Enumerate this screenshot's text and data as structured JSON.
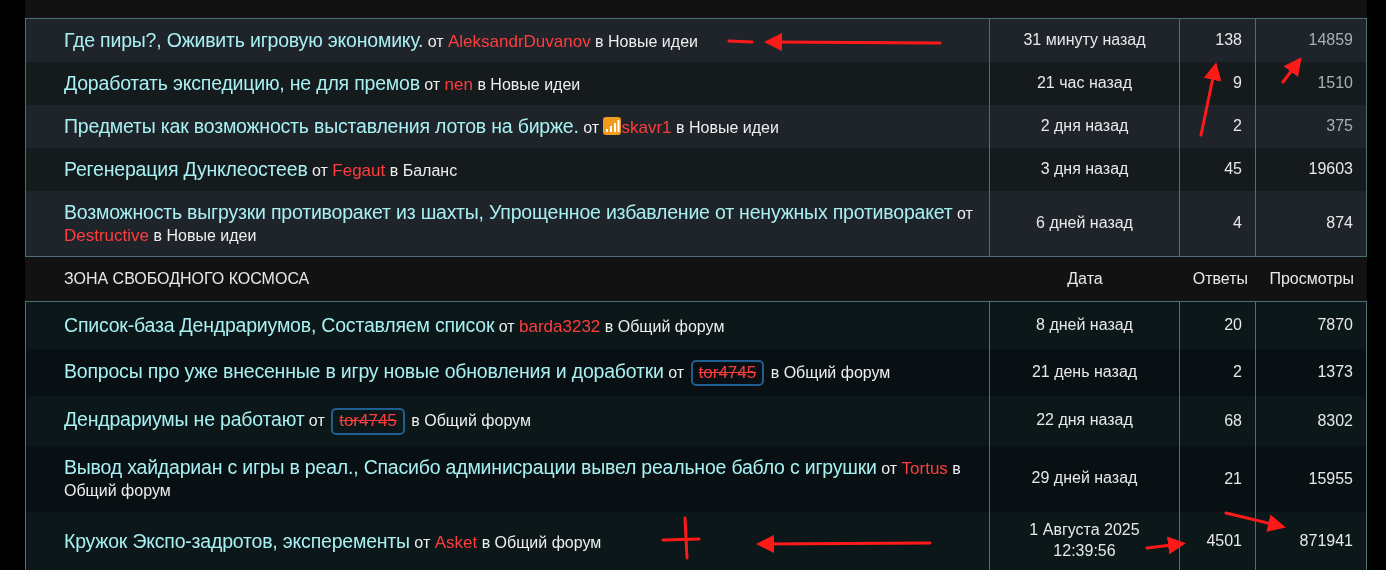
{
  "sections": [
    {
      "rows": [
        {
          "title": "Где пиры?, Оживить игровую экономику.",
          "byline": {
            "by": "от",
            "author": "AleksandrDuvanov",
            "kind": "plain",
            "in": "в",
            "forum": "Новые идеи"
          },
          "date": "31 минуту назад",
          "replies": "138",
          "views": "14859",
          "views_dim": true
        },
        {
          "title": "Доработать экспедицию, не для премов",
          "byline": {
            "by": "от",
            "author": "nen",
            "kind": "plain",
            "in": "в",
            "forum": "Новые идеи"
          },
          "date": "21 час назад",
          "replies": "9",
          "views": "1510",
          "views_dim": true
        },
        {
          "title": "Предметы как возможность выставления лотов на бирже.",
          "byline": {
            "by": "от",
            "author": "skavr1",
            "kind": "signal",
            "in": "в",
            "forum": "Новые идеи"
          },
          "date": "2 дня назад",
          "replies": "2",
          "views": "375",
          "views_dim": true
        },
        {
          "title": "Регенерация Дунклеостеев",
          "byline": {
            "by": "от",
            "author": "Fegaut",
            "kind": "plain",
            "in": "в",
            "forum": "Баланс"
          },
          "date": "3 дня назад",
          "replies": "45",
          "views": "19603",
          "views_dim": false
        },
        {
          "title": "Возможность выгрузки противоракет из шахты, Упрощенное избавление от ненужных противоракет",
          "byline": {
            "by": "от",
            "author": "Destructive",
            "kind": "plain",
            "in": "в",
            "forum": "Новые идеи"
          },
          "date": "6 дней назад",
          "replies": "4",
          "views": "874",
          "views_dim": false
        }
      ]
    },
    {
      "title": "ЗОНА СВОБОДНОГО КОСМОСА",
      "columns": [
        "Дата",
        "Ответы",
        "Просмотры"
      ],
      "rows": [
        {
          "title": "Список-база Дендрариумов, Составляем список",
          "byline": {
            "by": "от",
            "author": "barda3232",
            "kind": "plain",
            "in": "в",
            "forum": "Общий форум"
          },
          "date": "8 дней назад",
          "replies": "20",
          "views": "7870",
          "views_dim": false
        },
        {
          "title": "Вопросы про уже внесенные в игру новые обновления и доработки",
          "byline": {
            "by": "от",
            "author": "tor4745",
            "kind": "banned",
            "in": "в",
            "forum": "Общий форум"
          },
          "date": "21 день назад",
          "replies": "2",
          "views": "1373",
          "views_dim": false
        },
        {
          "title": "Дендрариумы не работают",
          "byline": {
            "by": "от",
            "author": "tor4745",
            "kind": "banned",
            "in": "в",
            "forum": "Общий форум"
          },
          "date": "22 дня назад",
          "replies": "68",
          "views": "8302",
          "views_dim": false
        },
        {
          "title": "Вывод хайдариан с игры в реал., Спасибо админисрации вывел реальное бабло с игрушки",
          "byline": {
            "by": "от",
            "author": "Tortus",
            "kind": "plain",
            "in": "в",
            "forum": "Общий форум"
          },
          "date": "29 дней назад",
          "replies": "21",
          "views": "15955",
          "views_dim": false
        },
        {
          "title": "Кружок Экспо-задротов, эксперементы",
          "byline": {
            "by": "от",
            "author": "Asket",
            "kind": "plain",
            "in": "в",
            "forum": "Общий форум"
          },
          "date": "1 Августа 2025",
          "time": "12:39:56",
          "replies": "4501",
          "views": "871941",
          "views_dim": false
        }
      ]
    }
  ]
}
